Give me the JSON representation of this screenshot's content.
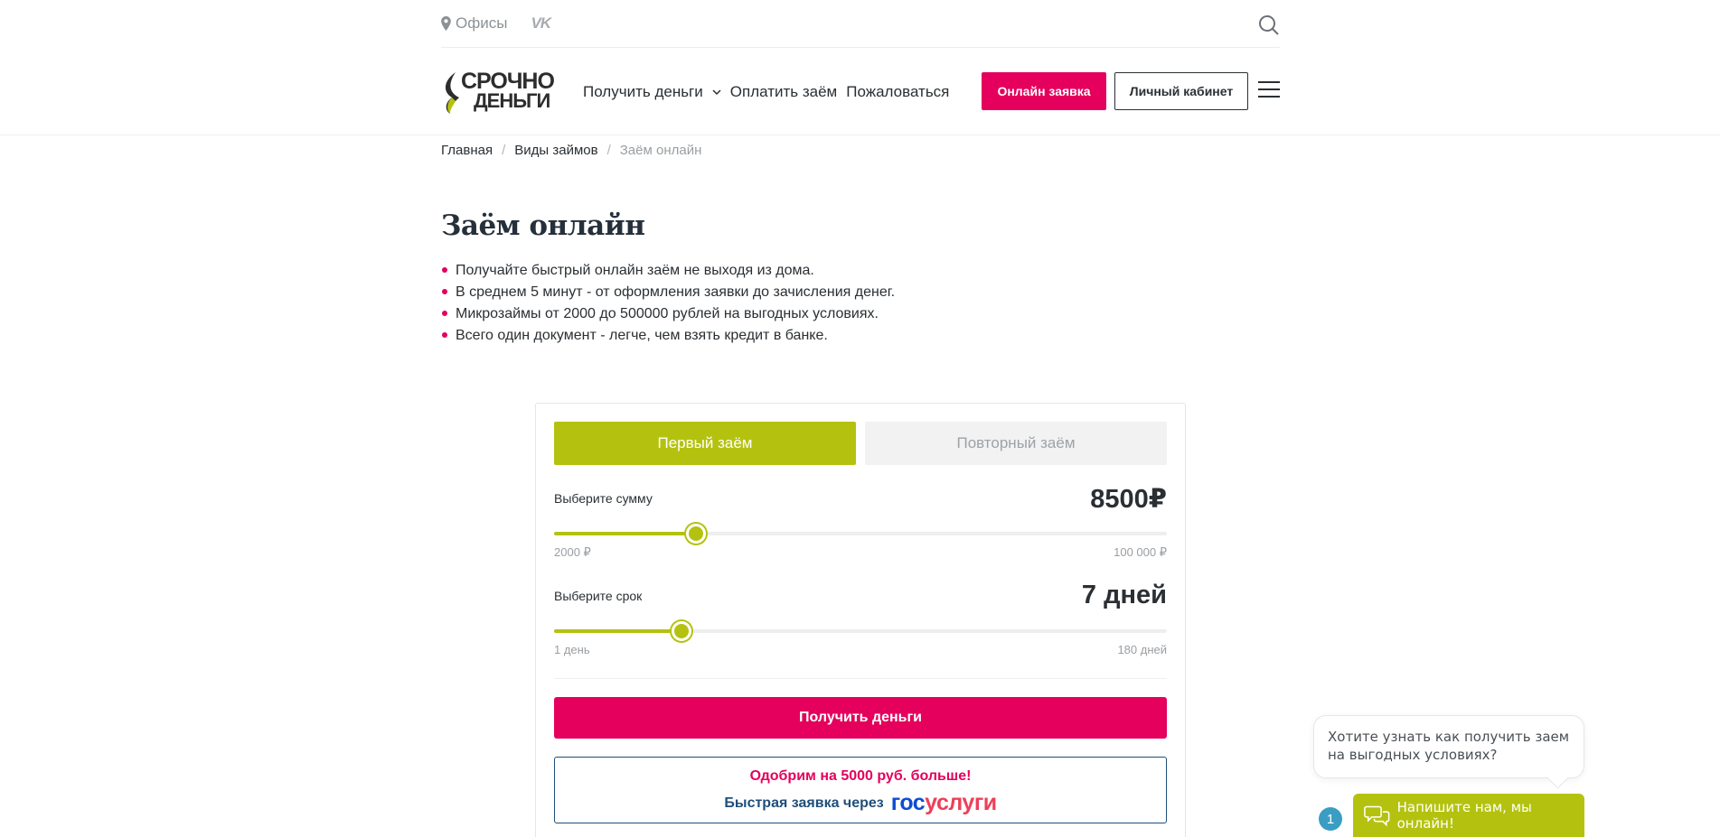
{
  "topbar": {
    "offices": "Офисы",
    "vk": "VK"
  },
  "header": {
    "logo": {
      "line1": "СРОЧНО",
      "line2": "ДЕНЬГИ"
    },
    "nav": [
      "Получить деньги",
      "Оплатить заём",
      "Пожаловаться"
    ],
    "online_button": "Онлайн заявка",
    "cabinet_button": "Личный кабинет"
  },
  "breadcrumb": [
    "Главная",
    "Виды займов",
    "Заём онлайн"
  ],
  "main": {
    "title": "Заём онлайн",
    "bullets": [
      "Получайте быстрый онлайн заём не выходя из дома.",
      "В среднем 5 минут - от оформления заявки до зачисления денег.",
      "Микрозаймы от 2000 до 500000 рублей на выгодных условиях.",
      "Всего один документ - легче, чем взять кредит в банке."
    ]
  },
  "calculator": {
    "tabs": [
      "Первый заём",
      "Повторный заём"
    ],
    "active_tab": 0,
    "amount": {
      "label": "Выберите сумму",
      "value": "8500₽",
      "min": "2000 ₽",
      "max": "100 000 ₽",
      "fraction": 0.2317
    },
    "term": {
      "label": "Выберите срок",
      "value": "7 дней",
      "min": "1 день",
      "max": "180 дней",
      "fraction": 0.2075
    },
    "submit": "Получить деньги",
    "gosuslugi": {
      "line1": "Одобрим на 5000 руб. больше!",
      "line2": "Быстрая заявка через",
      "logo_a": "гос",
      "logo_b": "услуги"
    }
  },
  "chat": {
    "bubble": "Хотите узнать как получить заем на выгодных условиях?",
    "badge": "1",
    "button": "Напишите нам, мы онлайн!"
  },
  "colors": {
    "accent": "#b4c20f",
    "brand_pink": "#e4005c",
    "gos_blue": "#0d4cd3",
    "gos_red": "#ee3f58"
  }
}
